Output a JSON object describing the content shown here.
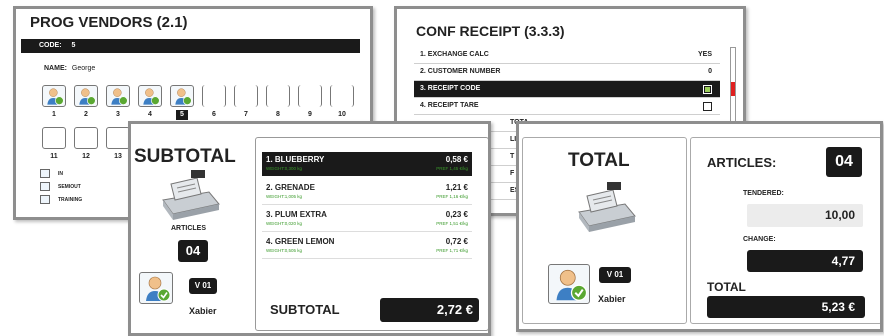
{
  "prog_vendors": {
    "title": "PROG VENDORS  (2.1)",
    "code_label": "CODE:",
    "code_value": "5",
    "name_label": "NAME:",
    "name_value": "George",
    "slots_row1": [
      "1",
      "2",
      "3",
      "4",
      "5",
      "6",
      "7",
      "8",
      "9",
      "10"
    ],
    "slots_row2": [
      "11",
      "12",
      "13"
    ],
    "selected_slot": "5",
    "legend": [
      "IN",
      "SEMIOUT",
      "TRAINING"
    ]
  },
  "conf_receipt": {
    "title": "CONF RECEIPT  (3.3.3)",
    "rows": [
      {
        "label": "1. EXCHANGE CALC",
        "value": "YES"
      },
      {
        "label": "2. CUSTOMER NUMBER",
        "value": "0"
      },
      {
        "label": "3. RECEIPT CODE",
        "value": ""
      },
      {
        "label": "4. RECEIPT TARE",
        "value": ""
      },
      {
        "label": "TOTA",
        "value": ""
      },
      {
        "label": "LINE",
        "value": ""
      },
      {
        "label": "T",
        "value": ""
      },
      {
        "label": "F",
        "value": ""
      },
      {
        "label": "ES",
        "value": ""
      }
    ]
  },
  "subtotal_screen": {
    "title": "SUBTOTAL",
    "articles_label": "ARTICLES",
    "articles_value": "04",
    "vendor_code": "V 01",
    "vendor_name": "Xabier",
    "items": [
      {
        "name": "1. BLUEBERRY",
        "price": "0,58 €",
        "weight": "WEIGHT:0,300 kg",
        "pref": "PREF 1,45 €/kg"
      },
      {
        "name": "2. GRENADE",
        "price": "1,21 €",
        "weight": "WEIGHT:1,005 kg",
        "pref": "PREF 1,16 €/kg"
      },
      {
        "name": "3. PLUM EXTRA",
        "price": "0,23 €",
        "weight": "WEIGHT:0,020 kg",
        "pref": "PREF 1,51 €/kg"
      },
      {
        "name": "4. GREEN LEMON",
        "price": "0,72 €",
        "weight": "WEIGHT:0,505 kg",
        "pref": "PREF 1,71 €/kg"
      }
    ],
    "subtotal_label": "SUBTOTAL",
    "subtotal_value": "2,72 €"
  },
  "total_screen": {
    "title": "TOTAL",
    "vendor_code": "V 01",
    "vendor_name": "Xabier",
    "articles_label": "ARTICLES:",
    "articles_value": "04",
    "tendered_label": "TENDERED:",
    "tendered_value": "10,00",
    "change_label": "CHANGE:",
    "change_value": "4,77",
    "total_label": "TOTAL",
    "total_value": "5,23  €"
  }
}
